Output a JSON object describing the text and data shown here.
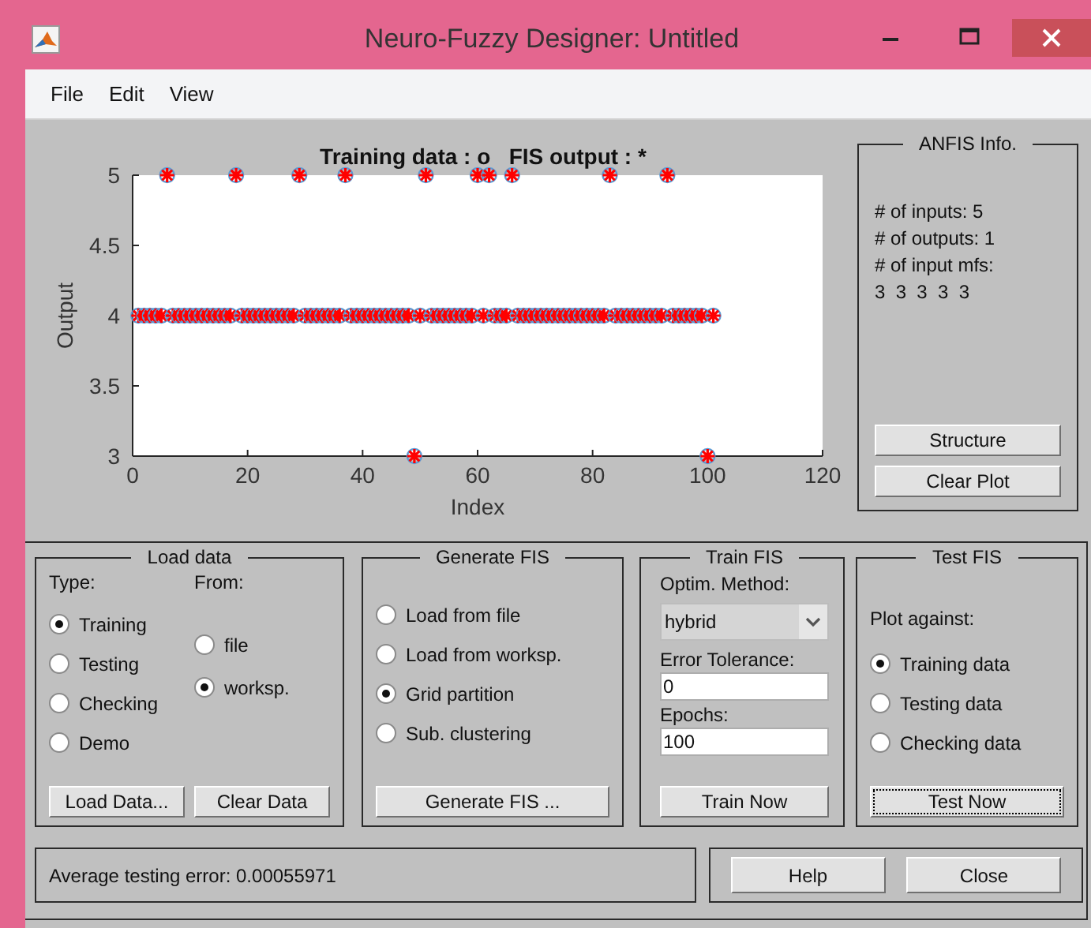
{
  "window": {
    "title": "Neuro-Fuzzy Designer: Untitled"
  },
  "menu": [
    "File",
    "Edit",
    "View"
  ],
  "plot": {
    "chart_data": {
      "type": "scatter",
      "title": "Training data : o   FIS output : *",
      "xlabel": "Index",
      "ylabel": "Output",
      "x": [
        1,
        2,
        3,
        4,
        5,
        6,
        7,
        8,
        9,
        10,
        11,
        12,
        13,
        14,
        15,
        16,
        17,
        18,
        19,
        20,
        21,
        22,
        23,
        24,
        25,
        26,
        27,
        28,
        29,
        30,
        31,
        32,
        33,
        34,
        35,
        36,
        37,
        38,
        39,
        40,
        41,
        42,
        43,
        44,
        45,
        46,
        47,
        48,
        49,
        50,
        51,
        52,
        53,
        54,
        55,
        56,
        57,
        58,
        59,
        60,
        61,
        62,
        63,
        64,
        65,
        66,
        67,
        68,
        69,
        70,
        71,
        72,
        73,
        74,
        75,
        76,
        77,
        78,
        79,
        80,
        81,
        82,
        83,
        84,
        85,
        86,
        87,
        88,
        89,
        90,
        91,
        92,
        93,
        94,
        95,
        96,
        97,
        98,
        99,
        100,
        101
      ],
      "series": [
        {
          "color": "#5b9bd5",
          "values": [
            4,
            4,
            4,
            4,
            4,
            5,
            4,
            4,
            4,
            4,
            4,
            4,
            4,
            4,
            4,
            4,
            4,
            5,
            4,
            4,
            4,
            4,
            4,
            4,
            4,
            4,
            4,
            4,
            5,
            4,
            4,
            4,
            4,
            4,
            4,
            4,
            5,
            4,
            4,
            4,
            4,
            4,
            4,
            4,
            4,
            4,
            4,
            4,
            3,
            4,
            5,
            4,
            4,
            4,
            4,
            4,
            4,
            4,
            4,
            5,
            4,
            5,
            4,
            4,
            4,
            5,
            4,
            4,
            4,
            4,
            4,
            4,
            4,
            4,
            4,
            4,
            4,
            4,
            4,
            4,
            4,
            4,
            5,
            4,
            4,
            4,
            4,
            4,
            4,
            4,
            4,
            4,
            5,
            4,
            4,
            4,
            4,
            4,
            4,
            3,
            4
          ]
        },
        {
          "color": "#ff0000",
          "values": [
            4,
            4,
            4,
            4,
            4,
            5,
            4,
            4,
            4,
            4,
            4,
            4,
            4,
            4,
            4,
            4,
            4,
            5,
            4,
            4,
            4,
            4,
            4,
            4,
            4,
            4,
            4,
            4,
            5,
            4,
            4,
            4,
            4,
            4,
            4,
            4,
            5,
            4,
            4,
            4,
            4,
            4,
            4,
            4,
            4,
            4,
            4,
            4,
            3,
            4,
            5,
            4,
            4,
            4,
            4,
            4,
            4,
            4,
            4,
            5,
            4,
            5,
            4,
            4,
            4,
            5,
            4,
            4,
            4,
            4,
            4,
            4,
            4,
            4,
            4,
            4,
            4,
            4,
            4,
            4,
            4,
            4,
            5,
            4,
            4,
            4,
            4,
            4,
            4,
            4,
            4,
            4,
            5,
            4,
            4,
            4,
            4,
            4,
            4,
            3,
            4
          ]
        }
      ],
      "xlim": [
        0,
        120
      ],
      "ylim": [
        3,
        5
      ],
      "xticks": [
        0,
        20,
        40,
        60,
        80,
        100,
        120
      ],
      "yticks": [
        3,
        3.5,
        4,
        4.5,
        5
      ]
    }
  },
  "anfis_info": {
    "title": "ANFIS Info.",
    "lines": [
      "# of inputs: 5",
      "# of outputs: 1",
      "# of input mfs:",
      "3  3  3  3  3"
    ],
    "buttons": [
      "Structure",
      "Clear Plot"
    ]
  },
  "load_data": {
    "title": "Load data",
    "type_label": "Type:",
    "from_label": "From:",
    "types": [
      {
        "label": "Training",
        "selected": true
      },
      {
        "label": "Testing",
        "selected": false
      },
      {
        "label": "Checking",
        "selected": false
      },
      {
        "label": "Demo",
        "selected": false
      }
    ],
    "sources": [
      {
        "label": "file",
        "selected": false
      },
      {
        "label": "worksp.",
        "selected": true
      }
    ],
    "buttons": [
      "Load Data...",
      "Clear Data"
    ]
  },
  "generate_fis": {
    "title": "Generate FIS",
    "options": [
      {
        "label": "Load from file",
        "selected": false
      },
      {
        "label": "Load from worksp.",
        "selected": false
      },
      {
        "label": "Grid partition",
        "selected": true
      },
      {
        "label": "Sub. clustering",
        "selected": false
      }
    ],
    "button": "Generate FIS ..."
  },
  "train_fis": {
    "title": "Train FIS",
    "method_label": "Optim. Method:",
    "method": "hybrid",
    "tolerance_label": "Error Tolerance:",
    "tolerance": "0",
    "epochs_label": "Epochs:",
    "epochs": "100",
    "button": "Train Now"
  },
  "test_fis": {
    "title": "Test FIS",
    "plot_label": "Plot against:",
    "options": [
      {
        "label": "Training data",
        "selected": true
      },
      {
        "label": "Testing data",
        "selected": false
      },
      {
        "label": "Checking data",
        "selected": false
      }
    ],
    "button": "Test Now",
    "focused": true
  },
  "status": "Average testing error: 0.00055971",
  "buttons": [
    "Help",
    "Close"
  ]
}
